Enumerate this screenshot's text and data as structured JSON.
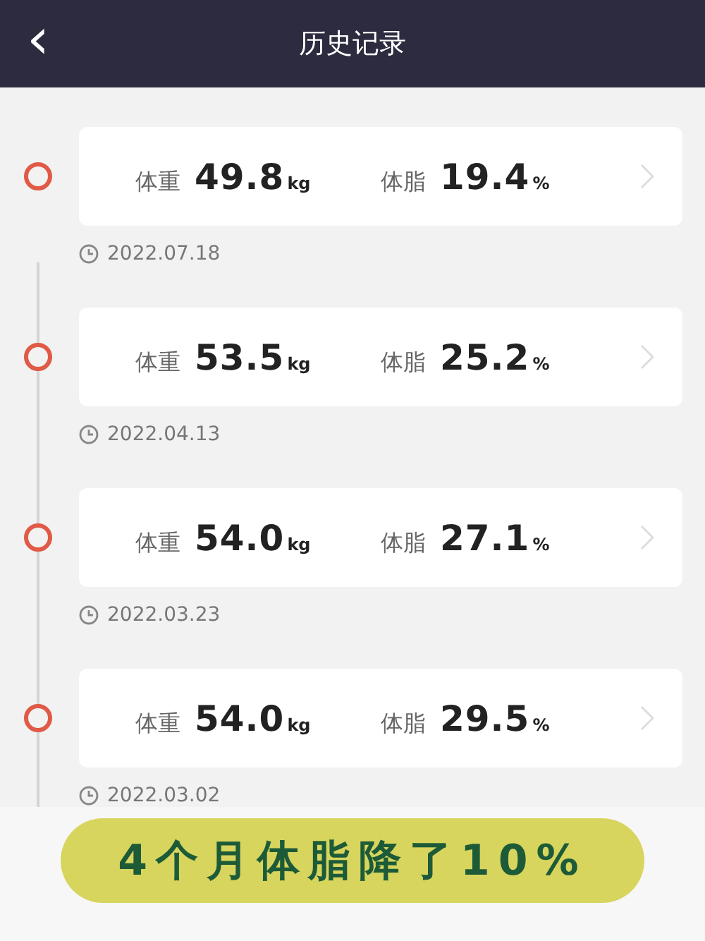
{
  "header": {
    "back_icon": "‹",
    "title": "历史记录"
  },
  "records": [
    {
      "weight_label": "体重",
      "weight": "49.8",
      "weight_unit": "kg",
      "fat_label": "体脂",
      "fat": "19.4",
      "fat_unit": "%",
      "date": "2022.07.18"
    },
    {
      "weight_label": "体重",
      "weight": "53.5",
      "weight_unit": "kg",
      "fat_label": "体脂",
      "fat": "25.2",
      "fat_unit": "%",
      "date": "2022.04.13"
    },
    {
      "weight_label": "体重",
      "weight": "54.0",
      "weight_unit": "kg",
      "fat_label": "体脂",
      "fat": "27.1",
      "fat_unit": "%",
      "date": "2022.03.23"
    },
    {
      "weight_label": "体重",
      "weight": "54.0",
      "weight_unit": "kg",
      "fat_label": "体脂",
      "fat": "29.5",
      "fat_unit": "%",
      "date": "2022.03.02"
    }
  ],
  "caption": "4个月体脂降了10%"
}
